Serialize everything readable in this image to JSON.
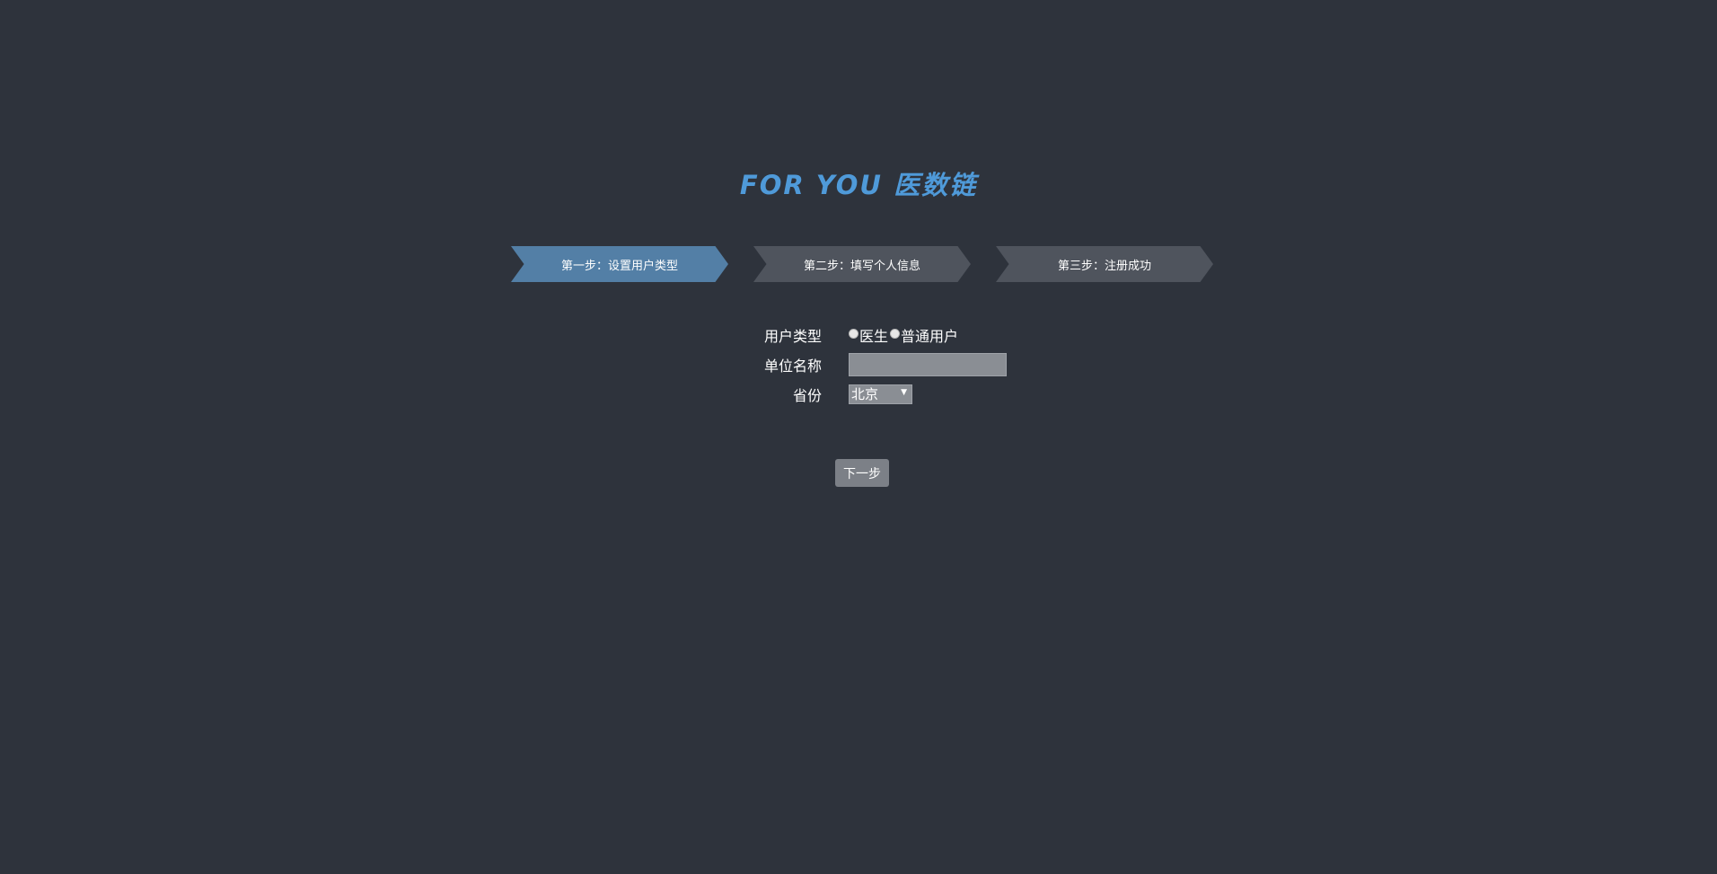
{
  "header": {
    "logo_text": "FOR YOU 医数链",
    "accent_color": "#4f9ad9"
  },
  "steps": {
    "items": [
      {
        "label": "第一步：设置用户类型",
        "active": true
      },
      {
        "label": "第二步：填写个人信息",
        "active": false
      },
      {
        "label": "第三步：注册成功",
        "active": false
      }
    ],
    "active_color": "#537fa6",
    "inactive_color": "#4f545d"
  },
  "form": {
    "user_type_label": "用户类型",
    "user_type_options": [
      "医生",
      "普通用户"
    ],
    "unit_name_label": "单位名称",
    "unit_name_value": "",
    "province_label": "省份",
    "province_selected": "北京"
  },
  "actions": {
    "next_label": "下一步"
  }
}
